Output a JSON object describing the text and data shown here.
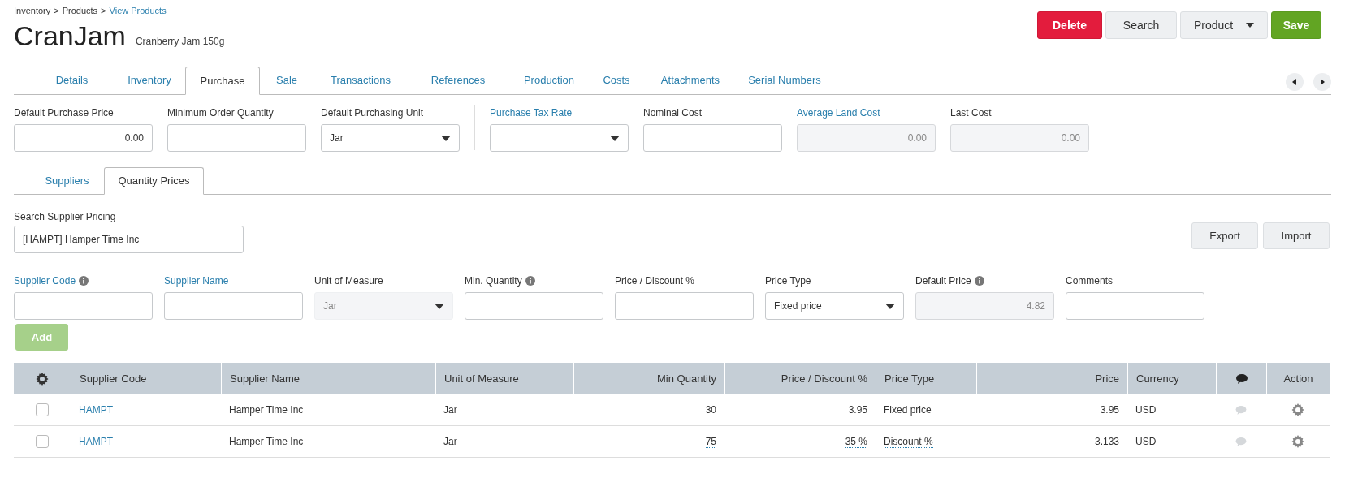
{
  "breadcrumb": [
    {
      "text": "Inventory",
      "kind": "text"
    },
    {
      "text": ">",
      "kind": "separator"
    },
    {
      "text": "Products",
      "kind": "text"
    },
    {
      "text": ">",
      "kind": "separator"
    },
    {
      "text": "View Products",
      "kind": "link"
    }
  ],
  "title": "CranJam",
  "subtitle": "Cranberry Jam 150g",
  "buttons": [
    {
      "label": "Delete",
      "kind": "danger"
    },
    {
      "label": "Search",
      "kind": "default"
    },
    {
      "label": "Product",
      "kind": "dropdown"
    },
    {
      "label": "Save",
      "kind": "primary"
    }
  ],
  "tabs": [
    {
      "label": "Details",
      "selected": false
    },
    {
      "label": "Inventory",
      "selected": false
    },
    {
      "label": "Purchase",
      "selected": true
    },
    {
      "label": "Sale",
      "selected": false
    },
    {
      "label": "Transactions",
      "selected": false
    },
    {
      "label": "References",
      "selected": false
    },
    {
      "label": "Production",
      "selected": false
    },
    {
      "label": "Costs",
      "selected": false
    },
    {
      "label": "Attachments",
      "selected": false
    },
    {
      "label": "Serial Numbers",
      "selected": false
    }
  ],
  "purchase_fields": [
    {
      "label": "Default Purchase Price",
      "kind": "text",
      "value": "0.00",
      "link": false
    },
    {
      "label": "Minimum Order Quantity",
      "kind": "text",
      "link": false
    },
    {
      "label": "Default Purchasing Unit",
      "kind": "select",
      "value": "Jar",
      "link": false
    },
    {
      "label": "Purchase Tax Rate",
      "kind": "select",
      "link": true,
      "divider_before": true
    },
    {
      "label": "Nominal Cost",
      "kind": "text",
      "link": false
    },
    {
      "label": "Average Land Cost",
      "kind": "readonly",
      "value": "0.00",
      "link": true
    },
    {
      "label": "Last Cost",
      "kind": "readonly",
      "value": "0.00",
      "link": false
    }
  ],
  "subtabs": [
    {
      "label": "Suppliers",
      "selected": false
    },
    {
      "label": "Quantity Prices",
      "selected": true
    }
  ],
  "search_supplier": {
    "label": "Search Supplier Pricing",
    "value": "[HAMPT] Hamper Time Inc"
  },
  "actions": [
    "Export",
    "Import"
  ],
  "entry_fields": [
    {
      "label": "Supplier Code",
      "kind": "text",
      "link": true,
      "info": true
    },
    {
      "label": "Supplier Name",
      "kind": "text",
      "link": true,
      "info": false
    },
    {
      "label": "Unit of Measure",
      "kind": "disabled_select",
      "value": "Jar",
      "link": false,
      "info": false
    },
    {
      "label": "Min. Quantity",
      "kind": "text",
      "link": false,
      "info": true
    },
    {
      "label": "Price / Discount %",
      "kind": "text",
      "link": false,
      "info": false
    },
    {
      "label": "Price Type",
      "kind": "select",
      "value": "Fixed price",
      "link": false,
      "info": false
    },
    {
      "label": "Default Price",
      "kind": "readonly",
      "value": "4.82",
      "link": false,
      "info": true
    },
    {
      "label": "Comments",
      "kind": "text",
      "link": false,
      "info": false
    }
  ],
  "add_button": {
    "label": "Add",
    "disabled": true
  },
  "table": {
    "columns": [
      {
        "kind": "check"
      },
      {
        "label": "Supplier Code",
        "kind": "link"
      },
      {
        "label": "Supplier Name",
        "kind": "text"
      },
      {
        "label": "Unit of Measure",
        "kind": "text"
      },
      {
        "label": "Min Quantity",
        "kind": "editable_number"
      },
      {
        "label": "Price / Discount %",
        "kind": "editable_number"
      },
      {
        "label": "Price Type",
        "kind": "editable_text"
      },
      {
        "label": "Price",
        "kind": "number"
      },
      {
        "label": "Currency",
        "kind": "text"
      },
      {
        "kind": "comment"
      },
      {
        "label": "Action",
        "kind": "action"
      }
    ],
    "rows": [
      {
        "checked": false,
        "cells": [
          "",
          "HAMPT",
          "Hamper Time Inc",
          "Jar",
          "30",
          "3.95",
          "Fixed price",
          "3.95",
          "USD",
          "",
          ""
        ]
      },
      {
        "checked": false,
        "cells": [
          "",
          "HAMPT",
          "Hamper Time Inc",
          "Jar",
          "75",
          "35 %",
          "Discount %",
          "3.133",
          "USD",
          "",
          ""
        ]
      }
    ]
  }
}
